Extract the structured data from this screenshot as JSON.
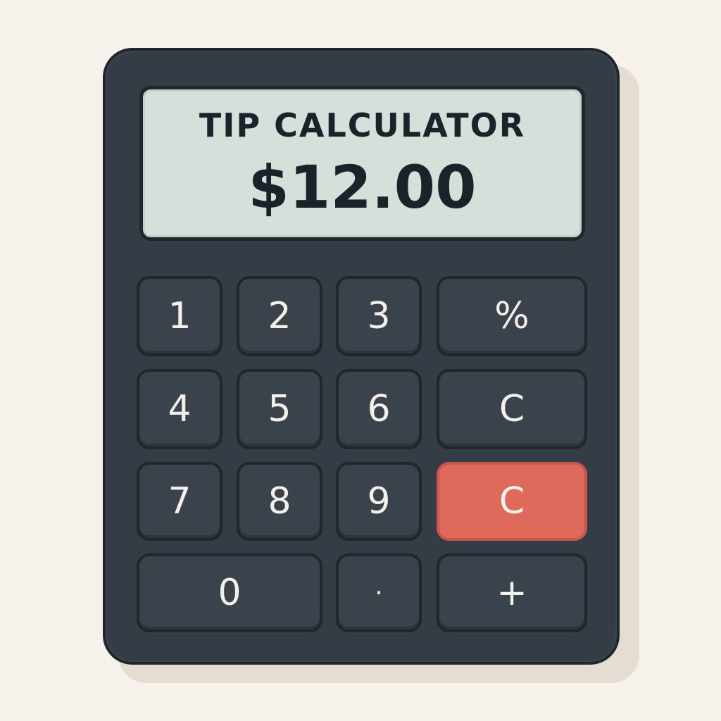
{
  "display": {
    "title": "TIP CALCULATOR",
    "value": "$12.00"
  },
  "keypad": {
    "k1": "1",
    "k2": "2",
    "k3": "3",
    "percent": "%",
    "k4": "4",
    "k5": "5",
    "k6": "6",
    "clear": "C",
    "k7": "7",
    "k8": "8",
    "k9": "9",
    "clear_red": "C",
    "k0": "0",
    "decimal": "·",
    "plus": "+"
  },
  "colors": {
    "body": "#343d45",
    "screen": "#d6dfd9",
    "accent_key": "#df6a5c",
    "background": "#f6f1ea"
  }
}
